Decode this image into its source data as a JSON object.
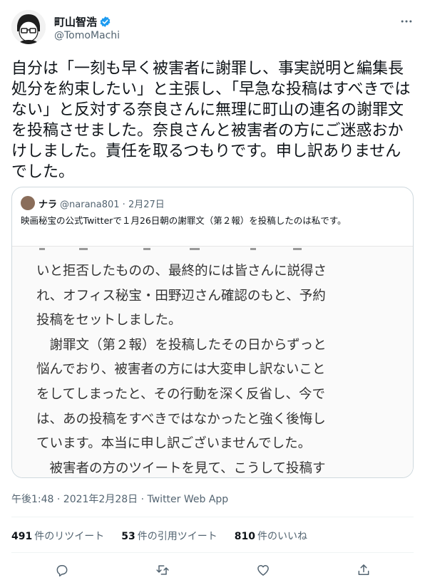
{
  "author": {
    "display_name": "町山智浩",
    "handle": "@TomoMachi"
  },
  "tweet": {
    "text": "自分は「一刻も早く被害者に謝罪し、事実説明と編集長処分を約束したい」と主張し、「早急な投稿はすべきではない」と反対する奈良さんに無理に町山の連名の謝罪文を投稿させました。奈良さんと被害者の方にご迷惑おかけしました。責任を取るつもりです。申し訳ありませんでした。"
  },
  "quote": {
    "name": "ナラ",
    "handle_date": "@narana801 · 2月27日",
    "text": "映画秘宝の公式Twitterで１月26日朝の謝罪文（第２報）を投稿したのは私です。",
    "image_lines": [
      "いと拒否したものの、最終的には皆さんに説得さ",
      "れ、オフィス秘宝・田野辺さん確認のもと、予約",
      "投稿をセットしました。",
      "　謝罪文（第２報）を投稿したその日からずっと",
      "悩んでおり、被害者の方には大変申し訳ないこと",
      "をしてしまったと、その行動を深く反省し、今で",
      "は、あの投稿をすべきではなかったと強く後悔し",
      "ています。本当に申し訳ございませんでした。",
      "　被害者の方のツイートを見て、こうして投稿す"
    ]
  },
  "meta": {
    "timestamp": "午後1:48 · 2021年2月28日 · Twitter Web App"
  },
  "stats": {
    "retweets_count": "491",
    "retweets_label": "件のリツイート",
    "quotes_count": "53",
    "quotes_label": "件の引用ツイート",
    "likes_count": "810",
    "likes_label": "件のいいね"
  },
  "colors": {
    "verified": "#1d9bf0",
    "secondary_text": "#536471",
    "border": "#cfd9de"
  },
  "icons": [
    "verified-icon",
    "more-icon",
    "reply-icon",
    "retweet-icon",
    "like-icon",
    "share-icon"
  ]
}
